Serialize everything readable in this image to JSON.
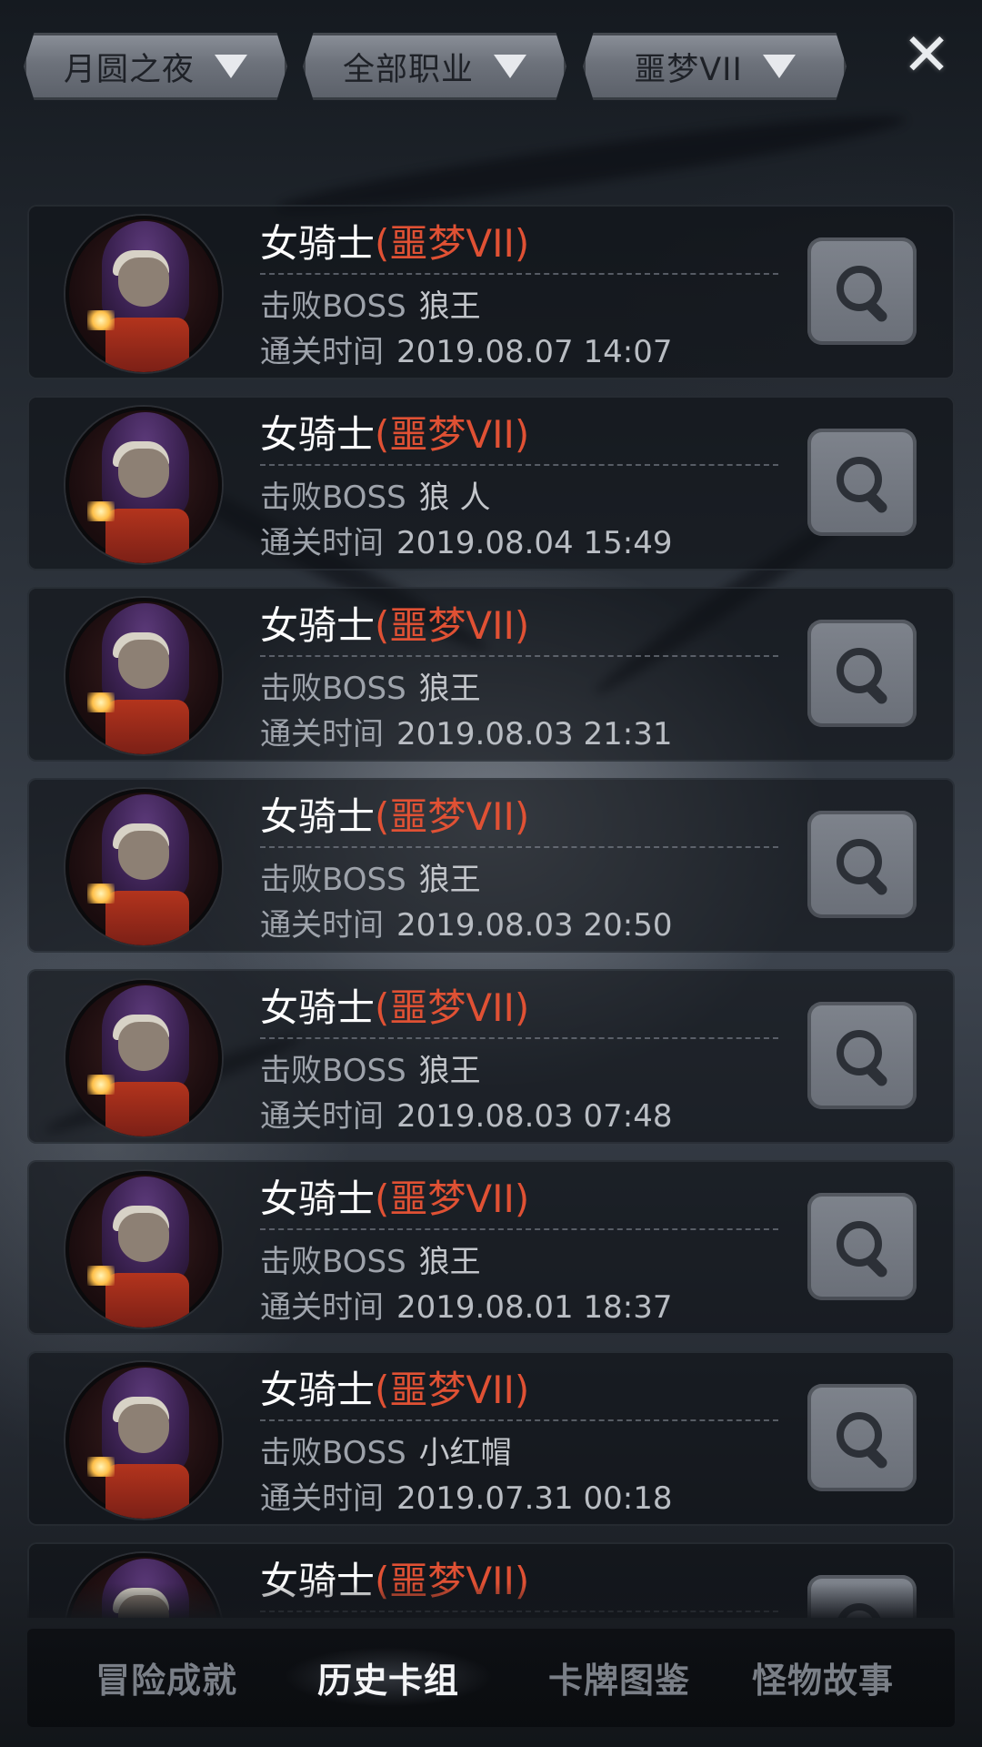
{
  "filters": [
    {
      "label": "月圆之夜"
    },
    {
      "label": "全部职业"
    },
    {
      "label": "噩梦VII"
    }
  ],
  "close_icon": "close-x-icon",
  "records": [
    {
      "hero": "女骑士",
      "difficulty": "(噩梦VII)",
      "boss_label": "击败BOSS",
      "boss": "狼王",
      "time_label": "通关时间",
      "time": "2019.08.07 14:07"
    },
    {
      "hero": "女骑士",
      "difficulty": "(噩梦VII)",
      "boss_label": "击败BOSS",
      "boss": "狼 人",
      "time_label": "通关时间",
      "time": "2019.08.04 15:49"
    },
    {
      "hero": "女骑士",
      "difficulty": "(噩梦VII)",
      "boss_label": "击败BOSS",
      "boss": "狼王",
      "time_label": "通关时间",
      "time": "2019.08.03 21:31"
    },
    {
      "hero": "女骑士",
      "difficulty": "(噩梦VII)",
      "boss_label": "击败BOSS",
      "boss": "狼王",
      "time_label": "通关时间",
      "time": "2019.08.03 20:50"
    },
    {
      "hero": "女骑士",
      "difficulty": "(噩梦VII)",
      "boss_label": "击败BOSS",
      "boss": "狼王",
      "time_label": "通关时间",
      "time": "2019.08.03 07:48"
    },
    {
      "hero": "女骑士",
      "difficulty": "(噩梦VII)",
      "boss_label": "击败BOSS",
      "boss": "狼王",
      "time_label": "通关时间",
      "time": "2019.08.01 18:37"
    },
    {
      "hero": "女骑士",
      "difficulty": "(噩梦VII)",
      "boss_label": "击败BOSS",
      "boss": "小红帽",
      "time_label": "通关时间",
      "time": "2019.07.31 00:18"
    },
    {
      "hero": "女骑士",
      "difficulty": "(噩梦VII)",
      "boss_label": "",
      "boss": "",
      "time_label": "",
      "time": ""
    }
  ],
  "tabs": [
    {
      "label": "冒险成就",
      "active": false
    },
    {
      "label": "历史卡组",
      "active": true
    },
    {
      "label": "卡牌图鉴",
      "active": false
    },
    {
      "label": "怪物故事",
      "active": false
    }
  ],
  "colors": {
    "hero_name": "#ffffff",
    "difficulty": "#e05134",
    "active_tab": "#f4f5f7",
    "inactive_tab": "#7a7f87"
  }
}
